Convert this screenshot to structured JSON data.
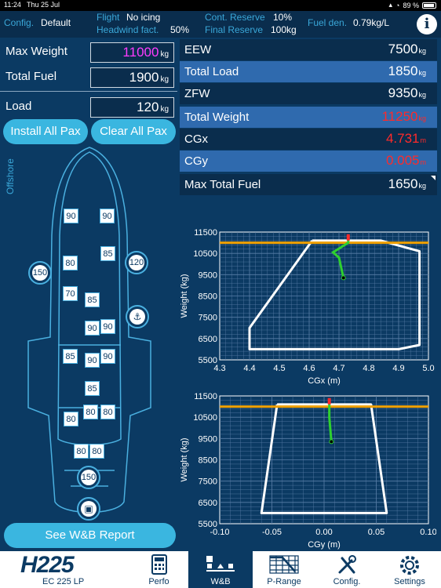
{
  "status": {
    "time": "11:24",
    "date": "Thu 25 Jul",
    "battery": "89 %"
  },
  "header": {
    "config_label": "Config.",
    "config_value": "Default",
    "flight_label": "Flight",
    "flight_value": "No icing",
    "headwind_label": "Headwind fact.",
    "headwind_value": "50%",
    "cont_label": "Cont. Reserve",
    "cont_value": "10%",
    "final_label": "Final Reserve",
    "final_value": "100kg",
    "fuelden_label": "Fuel den.",
    "fuelden_value": "0.79kg/L",
    "info": "i"
  },
  "inputs": {
    "max_weight_label": "Max Weight",
    "max_weight_value": "11000",
    "max_weight_unit": "kg",
    "total_fuel_label": "Total Fuel",
    "total_fuel_value": "1900",
    "total_fuel_unit": "kg",
    "load_label": "Load",
    "load_value": "120",
    "load_unit": "kg"
  },
  "buttons": {
    "install": "Install All Pax",
    "clear": "Clear All Pax",
    "report": "See W&B Report"
  },
  "side_label": "Offshore",
  "table": [
    {
      "name": "EEW",
      "value": "7500",
      "unit": "kg",
      "style": "dark",
      "color": "white"
    },
    {
      "name": "Total Load",
      "value": "1850",
      "unit": "kg",
      "style": "light",
      "color": "white"
    },
    {
      "name": "ZFW",
      "value": "9350",
      "unit": "kg",
      "style": "dark",
      "color": "white"
    },
    {
      "name": "Total Weight",
      "value": "11250",
      "unit": "kg",
      "style": "light",
      "color": "red"
    },
    {
      "name": "CGx",
      "value": "4.731",
      "unit": "m",
      "style": "dark",
      "color": "red"
    },
    {
      "name": "CGy",
      "value": "0.005",
      "unit": "m",
      "style": "light",
      "color": "red"
    },
    {
      "name": "Max Total Fuel",
      "value": "1650",
      "unit": "kg",
      "style": "dark",
      "color": "white"
    }
  ],
  "seats": [
    "90",
    "90",
    "80",
    "85",
    "70",
    "85",
    "90",
    "90",
    "85",
    "90",
    "90",
    "85",
    "80",
    "80",
    "80",
    "80",
    "80"
  ],
  "circle_seats": {
    "left": "150",
    "right": "120",
    "bottom": "150"
  },
  "colors": {
    "accent": "#3ab6e0",
    "background": "#0b3a63",
    "alert": "#ff2a2a",
    "limit_line": "#f0a000",
    "trend": "#2fd02f"
  },
  "chart_data": [
    {
      "type": "line",
      "xlabel": "CGx (m)",
      "ylabel": "Weight (kg)",
      "xlim": [
        4.3,
        5.0
      ],
      "ylim": [
        5500,
        11500
      ],
      "xticks": [
        "4.3",
        "4.4",
        "4.5",
        "4.6",
        "4.7",
        "4.8",
        "4.9",
        "5.0"
      ],
      "yticks": [
        "5500",
        "6500",
        "7500",
        "8500",
        "9500",
        "10500",
        "11500"
      ],
      "envelope": [
        [
          4.61,
          11100
        ],
        [
          4.84,
          11100
        ],
        [
          4.97,
          10600
        ],
        [
          4.97,
          6200
        ],
        [
          4.9,
          6000
        ],
        [
          4.4,
          6000
        ],
        [
          4.4,
          7000
        ],
        [
          4.61,
          11100
        ]
      ],
      "max_weight_line": 11000,
      "trend": [
        [
          4.715,
          9350
        ],
        [
          4.7,
          10300
        ],
        [
          4.68,
          10550
        ],
        [
          4.731,
          11000
        ],
        [
          4.731,
          11250
        ]
      ],
      "current_point": [
        4.731,
        11250
      ],
      "zfw_point": [
        4.715,
        9350
      ]
    },
    {
      "type": "line",
      "xlabel": "CGy (m)",
      "ylabel": "Weight (kg)",
      "xlim": [
        -0.1,
        0.1
      ],
      "ylim": [
        5500,
        11500
      ],
      "xticks": [
        "-0.10",
        "-0.05",
        "0.00",
        "0.05",
        "0.10"
      ],
      "yticks": [
        "5500",
        "6500",
        "7500",
        "8500",
        "9500",
        "10500",
        "11500"
      ],
      "envelope": [
        [
          -0.045,
          11100
        ],
        [
          0.045,
          11100
        ],
        [
          0.06,
          6000
        ],
        [
          -0.06,
          6000
        ],
        [
          -0.045,
          11100
        ]
      ],
      "max_weight_line": 11000,
      "trend": [
        [
          0.007,
          9350
        ],
        [
          0.005,
          10500
        ],
        [
          0.005,
          11000
        ],
        [
          0.005,
          11250
        ]
      ],
      "current_point": [
        0.005,
        11250
      ],
      "zfw_point": [
        0.007,
        9350
      ]
    }
  ],
  "tabbar": {
    "brand": "H225",
    "brand_sub": "EC 225 LP",
    "tabs": [
      {
        "label": "Perfo"
      },
      {
        "label": "W&B"
      },
      {
        "label": "P-Range"
      },
      {
        "label": "Config."
      },
      {
        "label": "Settings"
      }
    ]
  }
}
